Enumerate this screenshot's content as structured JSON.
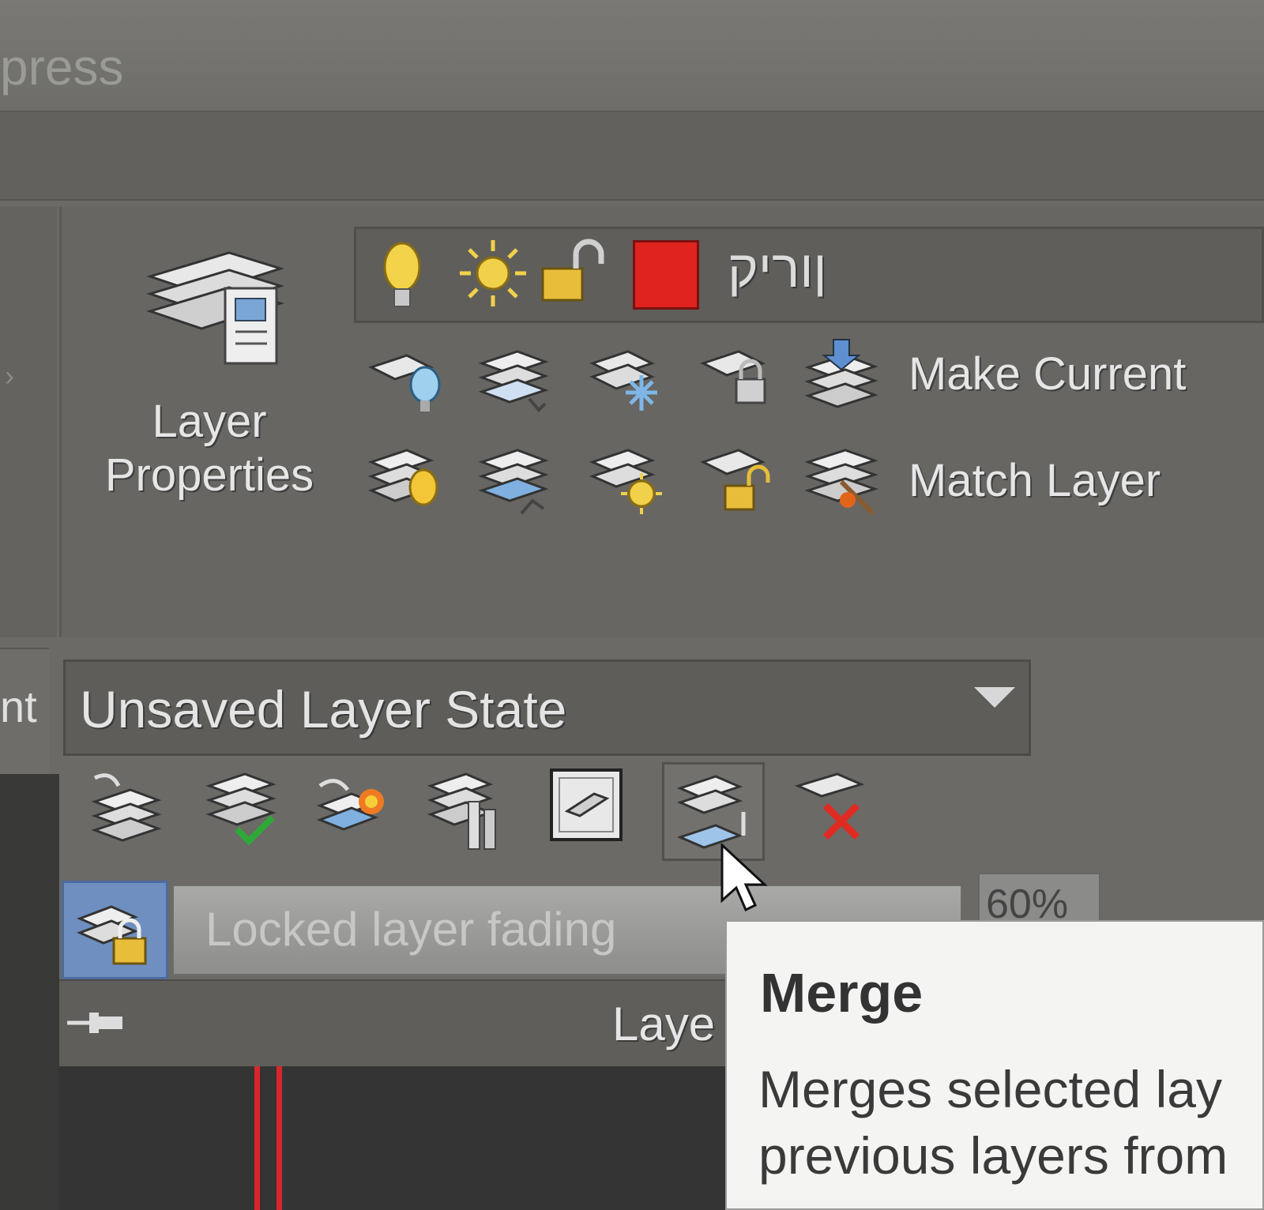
{
  "window": {
    "title_fragment": "press"
  },
  "layers_panel": {
    "layer_properties_label": "Layer\nProperties",
    "current_layer": {
      "name": "ןוריק",
      "color": "#e0231e"
    },
    "make_current_label": "Make Current",
    "match_layer_label": "Match Layer",
    "layer_state": "Unsaved Layer State",
    "locked_layer_fading_label": "Locked layer fading",
    "locked_fade_value": "60%",
    "panel_title_fragment": "Laye",
    "left_edge_text": "nt"
  },
  "tooltip": {
    "title": "Merge",
    "description": "Merges selected lay\nprevious layers from"
  },
  "icons": [
    "layer-properties-icon",
    "lightbulb-icon",
    "sun-icon",
    "unlock-icon",
    "color-swatch",
    "layer-off-icon",
    "layer-isolate-icon",
    "layer-freeze-icon",
    "layer-lock-icon",
    "make-current-icon",
    "layer-on-icon",
    "layer-unisolate-icon",
    "layer-thaw-icon",
    "layer-unlock-icon",
    "match-layer-icon",
    "layer-previous-icon",
    "change-to-current-icon",
    "layer-walk-icon",
    "isolate-to-current-icon",
    "vp-freeze-icon",
    "merge-icon",
    "delete-layer-icon",
    "lock-icon",
    "pin-icon",
    "cursor-icon"
  ]
}
